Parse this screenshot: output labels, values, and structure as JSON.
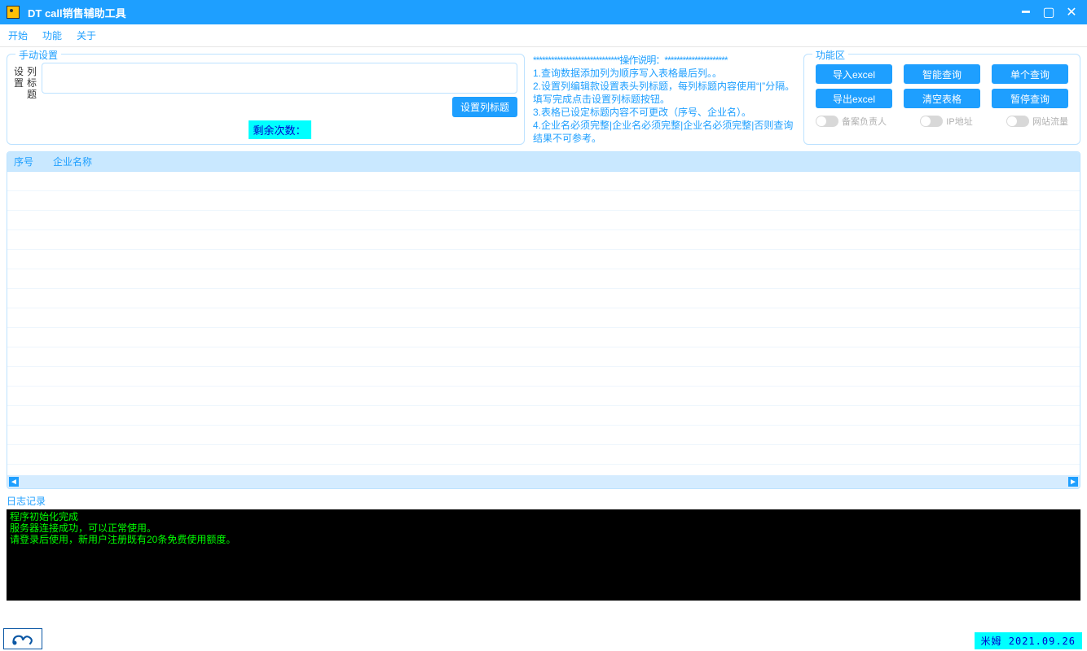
{
  "window": {
    "title": "DT call销售辅助工具"
  },
  "menu": {
    "start": "开始",
    "func": "功能",
    "about": "关于"
  },
  "manual": {
    "legend": "手动设置",
    "vlabel1": "设",
    "vlabel2": "置",
    "vlabel3": "列",
    "vlabel4": "标",
    "vlabel5": "题",
    "input_value": "",
    "set_btn": "设置列标题",
    "remain": "剩余次数："
  },
  "instructions": {
    "star_head": "*****************************操作说明：*********************",
    "l1": "1.查询数据添加列为顺序写入表格最后列。。",
    "l2": "2.设置列编辑款设置表头列标题，每列标题内容使用“|”分隔。填写完成点击设置列标题按钮。",
    "l3": "3.表格已设定标题内容不可更改（序号、企业名）。",
    "l4": "4.企业名必须完整|企业名必须完整|企业名必须完整|否则查询结果不可参考。",
    "star_foot": "***********************************************************************"
  },
  "func": {
    "legend": "功能区",
    "import": "导入excel",
    "smart": "智能查询",
    "single": "单个查询",
    "export": "导出excel",
    "clear": "清空表格",
    "pause": "暂停查询",
    "t1": "备案负责人",
    "t2": "IP地址",
    "t3": "网站流量"
  },
  "table": {
    "col1": "序号",
    "col2": "企业名称"
  },
  "log": {
    "legend": "日志记录",
    "l1": "程序初始化完成",
    "l2": "服务器连接成功，可以正常使用。",
    "l3": "请登录后使用，新用户注册既有20条免费使用额度。"
  },
  "status": {
    "right": "米姆 2021.09.26"
  }
}
